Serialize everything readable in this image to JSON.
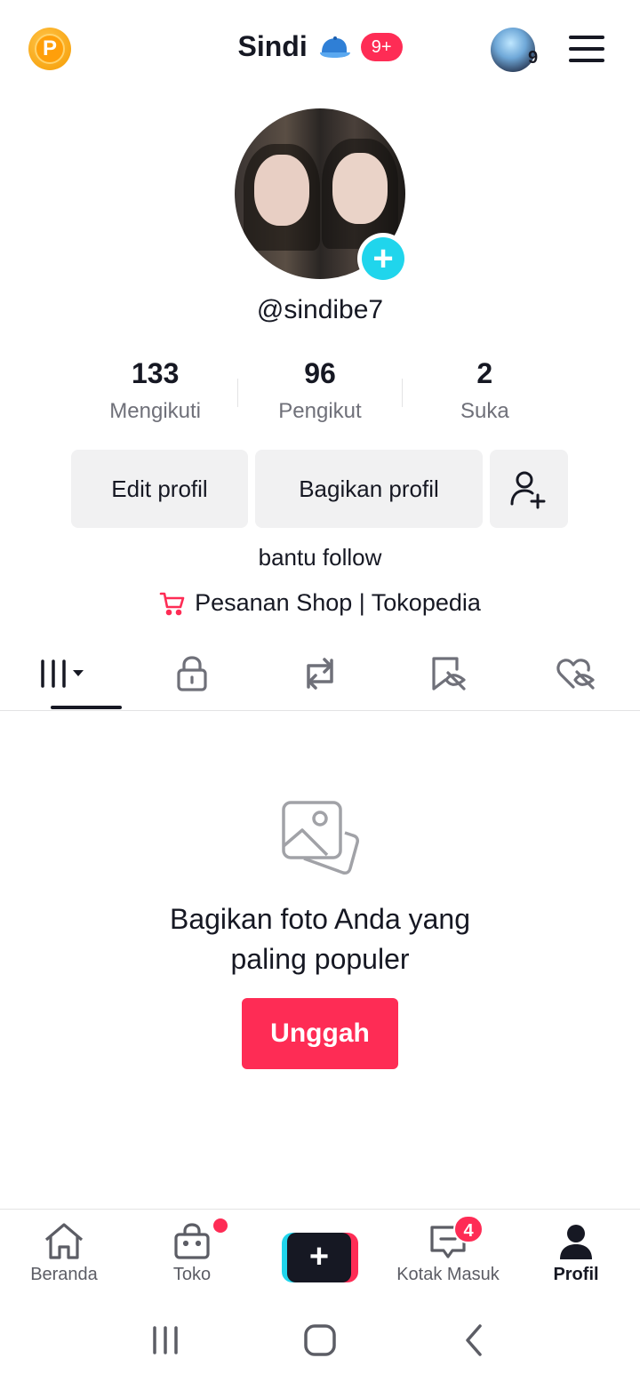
{
  "header": {
    "coin_letter": "P",
    "title": "Sindi",
    "notif_badge": "9+",
    "story_count": "9"
  },
  "profile": {
    "username": "@sindibe7",
    "stats": [
      {
        "value": "133",
        "label": "Mengikuti"
      },
      {
        "value": "96",
        "label": "Pengikut"
      },
      {
        "value": "2",
        "label": "Suka"
      }
    ],
    "edit_label": "Edit profil",
    "share_label": "Bagikan profil",
    "bio": "bantu follow",
    "shop_label": "Pesanan Shop | Tokopedia"
  },
  "tabs": [
    {
      "icon": "grid-icon",
      "active": true
    },
    {
      "icon": "lock-icon",
      "active": false
    },
    {
      "icon": "repost-icon",
      "active": false
    },
    {
      "icon": "bookmark-hidden-icon",
      "active": false
    },
    {
      "icon": "heart-hidden-icon",
      "active": false
    }
  ],
  "empty_state": {
    "line1": "Bagikan foto Anda yang",
    "line2": "paling populer",
    "upload_label": "Unggah"
  },
  "bottom_nav": {
    "home": "Beranda",
    "shop": "Toko",
    "inbox": "Kotak Masuk",
    "inbox_badge": "4",
    "profile": "Profil"
  },
  "colors": {
    "accent": "#fe2c55",
    "cyan": "#20d5ec",
    "text": "#161823",
    "secondary": "#6f7079"
  }
}
